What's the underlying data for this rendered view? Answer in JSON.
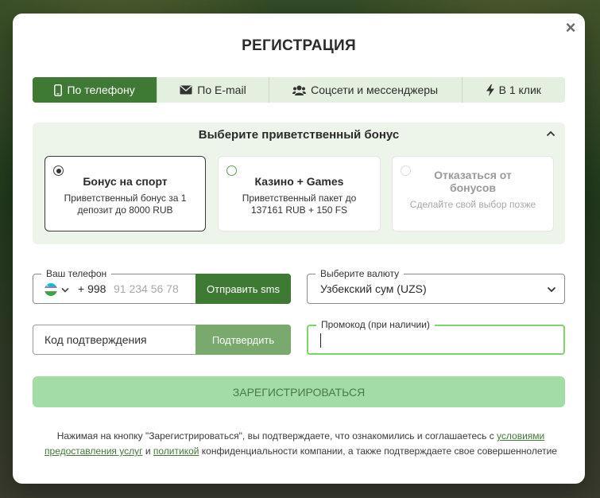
{
  "modal": {
    "title": "РЕГИСТРАЦИЯ",
    "close_symbol": "×"
  },
  "tabs": [
    {
      "label": "По телефону",
      "icon": "phone-icon",
      "active": true
    },
    {
      "label": "По E-mail",
      "icon": "envelope-icon",
      "active": false
    },
    {
      "label": "Соцсети и мессенджеры",
      "icon": "users-icon",
      "active": false
    },
    {
      "label": "В 1 клик",
      "icon": "lightning-icon",
      "active": false
    }
  ],
  "bonus": {
    "heading": "Выберите приветственный бонус",
    "options": [
      {
        "title": "Бонус на спорт",
        "description": "Приветственный бонус за 1 депозит до 8000 RUB",
        "selected": true
      },
      {
        "title": "Казино + Games",
        "description": "Приветственный пакет до 137161 RUB + 150 FS",
        "selected": false
      },
      {
        "title": "Отказаться от бонусов",
        "description": "Сделайте свой выбор позже",
        "selected": false
      }
    ]
  },
  "phone": {
    "label": "Ваш телефон",
    "flag": "uzbekistan-flag-icon",
    "code": "+ 998",
    "placeholder": "91 234 56 78",
    "send_button": "Отправить sms"
  },
  "currency": {
    "label": "Выберите валюту",
    "value": "Узбекский сум (UZS)"
  },
  "code": {
    "placeholder": "Код подтверждения",
    "confirm_button": "Подтвердить"
  },
  "promo": {
    "label": "Промокод (при наличии)",
    "value": ""
  },
  "register_button": "ЗАРЕГИСТРИРОВАТЬСЯ",
  "terms": {
    "part1": "Нажимая на кнопку \"Зарегистрироваться\", вы подтверждаете, что ознакомились и соглашаетесь с ",
    "link1": "условиями предоставления услуг",
    "part2": " и ",
    "link2": "политикой",
    "part3": " конфиденциальности компании, а также подтверждаете свое совершеннолетие"
  },
  "colors": {
    "primary": "#3f7a34",
    "tab_bg": "#e3efdf",
    "register_bg": "#a3dca6",
    "promo_border": "#7fd36b"
  }
}
